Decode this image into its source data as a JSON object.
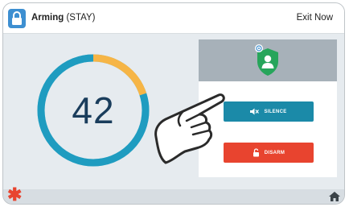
{
  "header": {
    "title_bold": "Arming",
    "title_mode": "(STAY)",
    "exit_label": "Exit Now",
    "lock_icon": "lock-icon"
  },
  "countdown": {
    "value": "42",
    "progress": 0.2
  },
  "panel": {
    "status_icon": "shield-person-icon",
    "silence_label": "SILENCE",
    "silence_icon": "speaker-mute-icon",
    "disarm_label": "DISARM",
    "disarm_icon": "unlock-icon"
  },
  "footer": {
    "left_icon": "asterisk-icon",
    "right_icon": "home-icon"
  },
  "colors": {
    "ring_track": "#6cc4dd",
    "ring_elapsed": "#f6b546",
    "silence": "#1b8aa8",
    "disarm": "#e8442f",
    "shield": "#27a55b"
  }
}
